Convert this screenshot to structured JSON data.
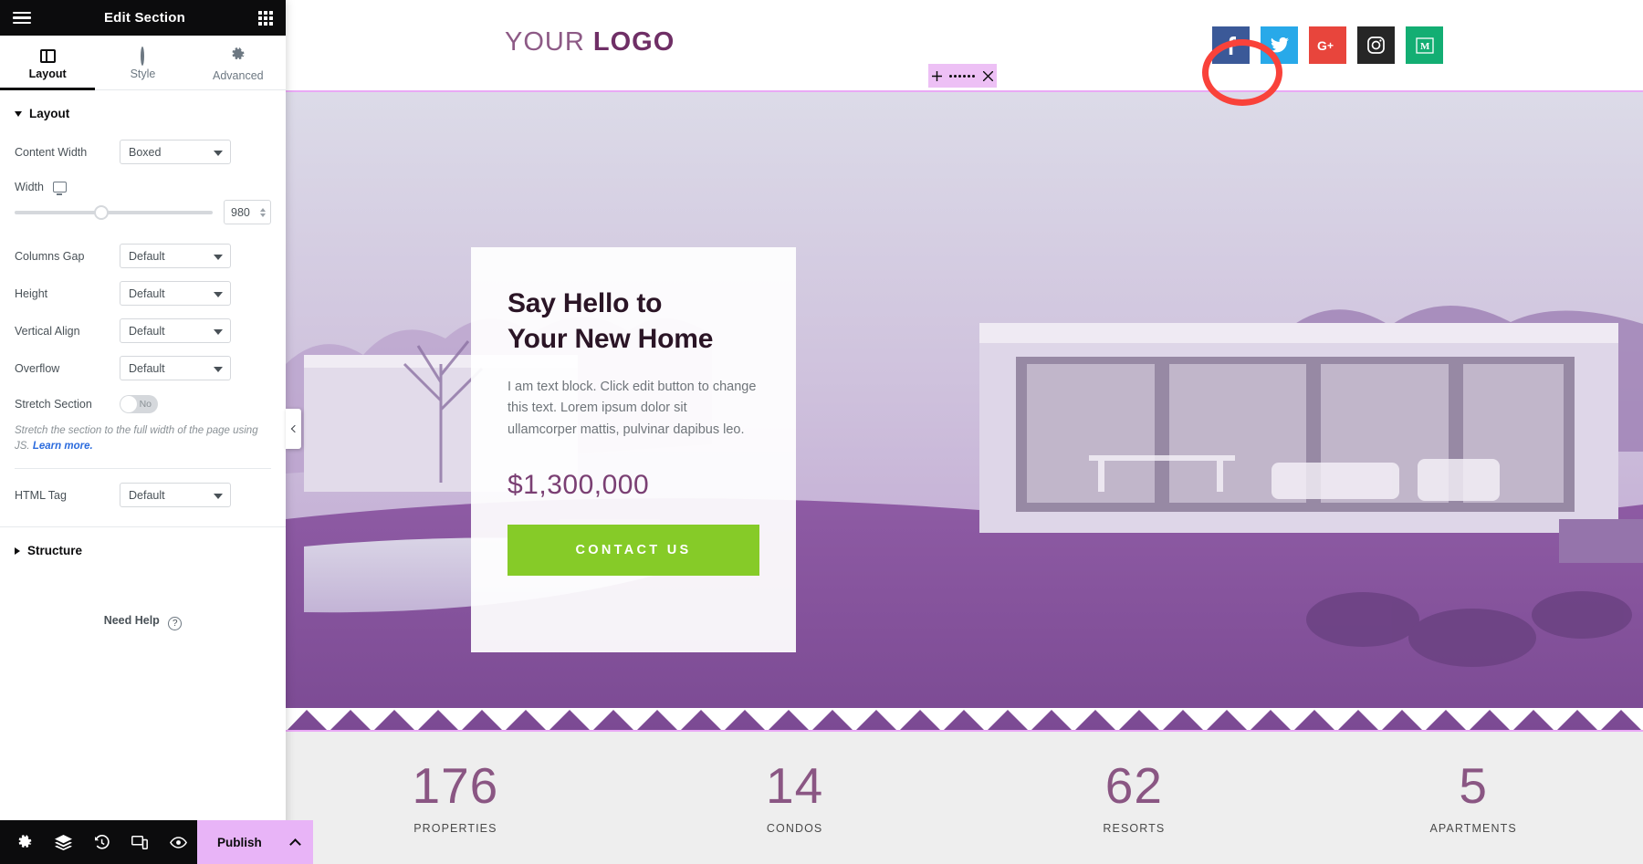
{
  "panel": {
    "header": {
      "title": "Edit Section",
      "menu_icon": "hamburger-icon",
      "apps_icon": "grid-icon"
    },
    "tabs": [
      {
        "label": "Layout",
        "icon": "layout-icon",
        "active": true
      },
      {
        "label": "Style",
        "icon": "contrast-icon",
        "active": false
      },
      {
        "label": "Advanced",
        "icon": "gear-icon",
        "active": false
      }
    ],
    "layout_section": {
      "title": "Layout",
      "expanded": true,
      "controls": [
        {
          "label": "Content Width",
          "type": "select",
          "value": "Boxed"
        },
        {
          "label": "Width",
          "type": "slider",
          "value": "980",
          "device_icon": "desktop-icon"
        },
        {
          "label": "Columns Gap",
          "type": "select",
          "value": "Default"
        },
        {
          "label": "Height",
          "type": "select",
          "value": "Default"
        },
        {
          "label": "Vertical Align",
          "type": "select",
          "value": "Default"
        },
        {
          "label": "Overflow",
          "type": "select",
          "value": "Default"
        },
        {
          "label": "Stretch Section",
          "type": "switch",
          "value": "No"
        },
        {
          "label": "HTML Tag",
          "type": "select",
          "value": "Default"
        }
      ],
      "stretch_hint": "Stretch the section to the full width of the page using JS.",
      "stretch_hint_link": "Learn more."
    },
    "structure_section": {
      "title": "Structure",
      "expanded": false
    },
    "need_help": {
      "label": "Need Help",
      "icon": "question-icon"
    },
    "footer": {
      "icons": [
        {
          "name": "settings-gear-icon"
        },
        {
          "name": "layers-navigator-icon"
        },
        {
          "name": "history-icon"
        },
        {
          "name": "responsive-mode-icon"
        },
        {
          "name": "preview-eye-icon"
        }
      ],
      "publish_label": "Publish",
      "publish_chevron": "chevron-up-icon"
    },
    "collapse_handle": "chevron-left-icon"
  },
  "preview": {
    "logo": {
      "first": "YOUR",
      "second": "LOGO"
    },
    "socials": [
      {
        "name": "facebook-icon",
        "color": "#3b5998",
        "glyph": "f"
      },
      {
        "name": "twitter-icon",
        "color": "#28a9e9",
        "glyph": "t"
      },
      {
        "name": "google-plus-icon",
        "color": "#e8453c",
        "glyph": "G+"
      },
      {
        "name": "instagram-icon",
        "color": "#262626",
        "glyph": "ig"
      },
      {
        "name": "medium-icon",
        "color": "#13ae73",
        "glyph": "M"
      }
    ],
    "section_toolbar": {
      "add_icon": "plus-icon",
      "drag_icon": "drag-handle-icon",
      "close_icon": "close-icon",
      "highlight_color": "#f9423a",
      "background_color": "#edc0f5"
    },
    "hero": {
      "heading_line1": "Say Hello to",
      "heading_line2": "Your New Home",
      "body": "I am text block. Click edit button to change this text. Lorem ipsum dolor sit ullamcorper mattis, pulvinar dapibus leo.",
      "price": "$1,300,000",
      "cta_label": "CONTACT US",
      "cta_color": "#86cb28",
      "price_color": "#7a3f73"
    },
    "stats": [
      {
        "number": "176",
        "caption": "PROPERTIES"
      },
      {
        "number": "14",
        "caption": "CONDOS"
      },
      {
        "number": "62",
        "caption": "RESORTS"
      },
      {
        "number": "5",
        "caption": "APARTMENTS"
      }
    ]
  }
}
